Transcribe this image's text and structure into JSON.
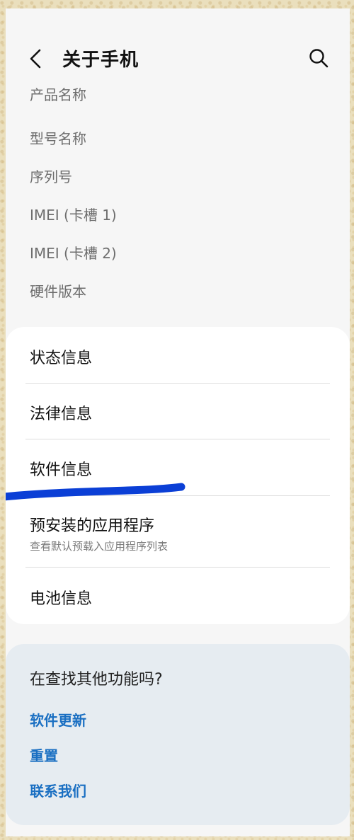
{
  "header": {
    "title": "关于手机",
    "back_icon": "back-arrow-icon",
    "search_icon": "search-icon"
  },
  "device_info": {
    "items": [
      {
        "label": "产品名称"
      },
      {
        "label": "型号名称"
      },
      {
        "label": "序列号"
      },
      {
        "label": "IMEI (卡槽 1)"
      },
      {
        "label": "IMEI (卡槽 2)"
      },
      {
        "label": "硬件版本"
      }
    ]
  },
  "menu": {
    "items": [
      {
        "label": "状态信息"
      },
      {
        "label": "法律信息"
      },
      {
        "label": "软件信息"
      },
      {
        "label": "预安装的应用程序",
        "subtitle": "查看默认预载入应用程序列表"
      },
      {
        "label": "电池信息"
      }
    ]
  },
  "lookup": {
    "title": "在查找其他功能吗?",
    "links": [
      {
        "label": "软件更新"
      },
      {
        "label": "重置"
      },
      {
        "label": "联系我们"
      }
    ]
  },
  "colors": {
    "link": "#1a6fc2",
    "annotation": "#0b3fd6"
  }
}
